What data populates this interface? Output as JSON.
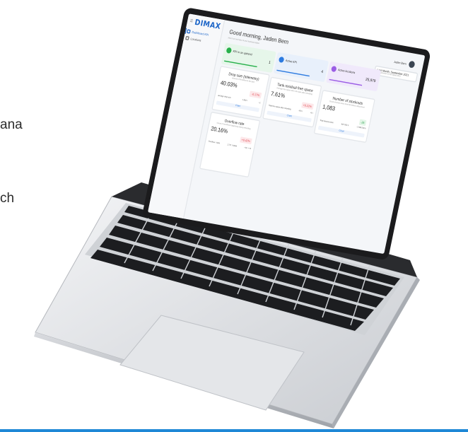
{
  "background_text": [
    "ana",
    "ch"
  ],
  "colors": {
    "brand": "#1e66c8",
    "accent_green": "#27b04b",
    "accent_blue": "#2d7be0",
    "accent_purple": "#9b5de5",
    "rule_blue": "#1e88d6"
  },
  "app": {
    "logo": "DIMAX",
    "nav": [
      {
        "label": "Dashboard KPI",
        "icon": "dashboard-icon"
      },
      {
        "label": "Locations",
        "icon": "locations-icon"
      }
    ],
    "greeting": "Good morning, Jaden Bern",
    "greeting_sub": "Here's an overview of your business status",
    "user": "Jaden Bern",
    "date_range": {
      "label": "Last Month, September 2021",
      "sub": "01 September to 30 August 2021"
    },
    "kpis": [
      {
        "label": "KPI in an uptrend",
        "value": "1"
      },
      {
        "label": "Active KPI",
        "value": "4"
      },
      {
        "label": "Active locations",
        "value": "25,979"
      }
    ],
    "cards": [
      {
        "title": "Drop size (telemetry)",
        "subtitle": "Amount of fill added to the tank",
        "value": "40.03%",
        "delta": "-0.17%",
        "row_label": "average drop size",
        "row_value": "1,552 l",
        "row_change": "+1",
        "chart_label": "Chart"
      },
      {
        "title": "Tank residual free space",
        "subtitle": "Average free space left in the tank after refuelling",
        "value": "7.61%",
        "delta": "+0.22%",
        "row_label": "Total free space after refuelling",
        "row_value": "476 l",
        "row_change": "+6 l",
        "chart_label": "Chart"
      },
      {
        "title": "Number of stockouts",
        "subtitle": "Count of times when level fell below critical level",
        "value": "1,083",
        "delta": "-26",
        "row_label": "Total stockout time",
        "row_value": "697 652 h",
        "row_change": "-1 588 509 h",
        "chart_label": "Chart"
      },
      {
        "title": "Overflow rate",
        "subtitle": "Count of overflows happening during refuelling",
        "value": "20.16%",
        "delta": "+0.42%",
        "row_label": "Overflow / visits",
        "row_value": "1,747 / 8,664",
        "row_change": "+14 / +70",
        "chart_label": "Chart"
      }
    ]
  }
}
